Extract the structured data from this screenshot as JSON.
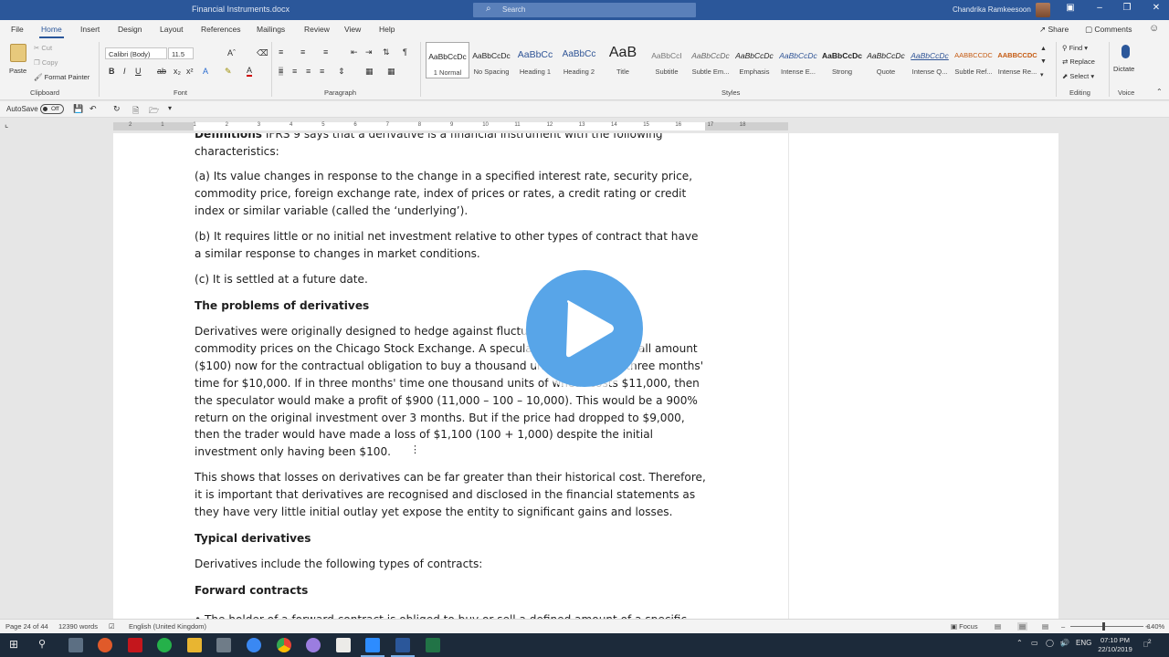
{
  "window": {
    "doc_title": "Financial Instruments.docx",
    "search_placeholder": "Search",
    "user_name": "Chandrika Ramkeesoon"
  },
  "tabs": [
    "File",
    "Home",
    "Insert",
    "Design",
    "Layout",
    "References",
    "Mailings",
    "Review",
    "View",
    "Help"
  ],
  "active_tab": "Home",
  "share_label": "Share",
  "comments_label": "Comments",
  "clipboard": {
    "paste": "Paste",
    "cut": "Cut",
    "copy": "Copy",
    "format_painter": "Format Painter",
    "group": "Clipboard"
  },
  "font": {
    "name": "Calibri (Body)",
    "size": "11.5",
    "group": "Font"
  },
  "paragraph_group": "Paragraph",
  "styles": {
    "group": "Styles",
    "items": [
      {
        "preview": "AaBbCcDc",
        "name": "1 Normal"
      },
      {
        "preview": "AaBbCcDc",
        "name": "No Spacing"
      },
      {
        "preview": "AaBbCc",
        "name": "Heading 1"
      },
      {
        "preview": "AaBbCc",
        "name": "Heading 2"
      },
      {
        "preview": "AaB",
        "name": "Title"
      },
      {
        "preview": "AaBbCcI",
        "name": "Subtitle"
      },
      {
        "preview": "AaBbCcDc",
        "name": "Subtle Em..."
      },
      {
        "preview": "AaBbCcDc",
        "name": "Emphasis"
      },
      {
        "preview": "AaBbCcDc",
        "name": "Intense E..."
      },
      {
        "preview": "AaBbCcDc",
        "name": "Strong"
      },
      {
        "preview": "AaBbCcDc",
        "name": "Quote"
      },
      {
        "preview": "AaBbCcDc",
        "name": "Intense Q..."
      },
      {
        "preview": "AABBCCDC",
        "name": "Subtle Ref..."
      },
      {
        "preview": "AABBCCDC",
        "name": "Intense Re..."
      }
    ]
  },
  "editing": {
    "find": "Find",
    "replace": "Replace",
    "select": "Select",
    "group": "Editing"
  },
  "voice": {
    "dictate": "Dictate",
    "group": "Voice"
  },
  "qat": {
    "autosave": "AutoSave",
    "toggle": "Off"
  },
  "document": {
    "p0_bold": "Definitions",
    "p0_rest": " IFRS 9 says that a derivative is a financial instrument with the following characteristics:",
    "p1": "(a) Its value changes in response to the change in a specified interest rate, security price, commodity price, foreign exchange rate, index of prices or rates, a credit rating or credit index or similar variable (called the ‘underlying’).",
    "p2": "(b) It requires little or no initial net investment relative to other types of contract that have a similar response to changes in market conditions.",
    "p3": " (c) It is settled at a future date.",
    "h1": "The problems of derivatives",
    "p4": "Derivatives were originally designed to hedge against fluctuations in agricultural commodity prices on the Chicago Stock Exchange. A speculator would pay a small amount ($100) now for the contractual obligation to buy a thousand units of wheat in three months' time for $10,000. If in three months' time one thousand units of wheat costs $11,000, then the speculator would make a profit of $900 (11,000 – 100 – 10,000). This would be a 900% return on the original investment over 3 months. But if the price had dropped to $9,000, then the trader would have made a loss of $1,100 (100 + 1,000) despite the initial investment only having been $100.",
    "p5": "This shows that losses on derivatives can be far greater than their historical cost. Therefore, it is important that derivatives are recognised and disclosed in the financial statements as they have very little initial outlay yet expose the entity to significant gains and losses.",
    "h2": "Typical derivatives",
    "p6": "Derivatives include the following types of contracts:",
    "h3": "Forward contracts",
    "p7": "• The holder of a forward contract is obliged to buy or sell a defined amount of a specific"
  },
  "status": {
    "page": "Page 24 of 44",
    "words": "12390 words",
    "language": "English (United Kingdom)",
    "focus": "Focus",
    "zoom": "140%"
  },
  "taskbar": {
    "lang": "ENG",
    "time": "07:10 PM",
    "date": "22/10/2019",
    "notifications": "2"
  },
  "ruler_numbers": [
    "2",
    "1",
    "1",
    "2",
    "3",
    "4",
    "5",
    "6",
    "7",
    "8",
    "9",
    "10",
    "11",
    "12",
    "13",
    "14",
    "15",
    "16",
    "17",
    "18"
  ]
}
